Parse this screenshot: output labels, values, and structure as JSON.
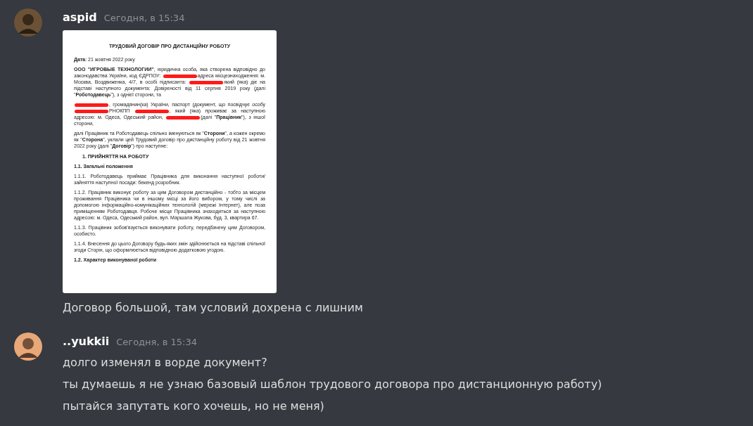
{
  "messages": [
    {
      "author": "aspid",
      "timestamp": "Сегодня, в 15:34",
      "attachment": {
        "kind": "document",
        "blocks": [
          {
            "kind": "title",
            "parts": [
              {
                "kind": "text",
                "text": "ТРУДОВИЙ ДОГОВІР ПРО ДИСТАНЦІЙНУ РОБОТУ"
              }
            ]
          },
          {
            "kind": "para",
            "parts": [
              {
                "kind": "text",
                "text": "**Дата**: 21 жовтня 2022 року"
              }
            ]
          },
          {
            "kind": "para",
            "parts": [
              {
                "kind": "text",
                "text": "**ООО \"ИГРОВЫЕ ТЕХНОЛОГИИ\"**, юридична особа, яка створена відповідно до законодавства України, код ЄДРПОУ:"
              },
              {
                "kind": "redaction"
              },
              {
                "kind": "text",
                "text": "адреса місцезнаходження: м. Москва, Воздвиженка, 4/7, в особі підписанта:"
              },
              {
                "kind": "redaction"
              },
              {
                "kind": "text",
                "text": "який (яка) діє на підставі наступного документа: Довіреності від 11 серпня 2019 року (далі \"**Роботодавець**\"), з однієї сторони, та"
              }
            ]
          },
          {
            "kind": "para",
            "parts": [
              {
                "kind": "redaction"
              },
              {
                "kind": "text",
                "text": ", громадянин(ка) України, паспорт (документ, що посвідчує особу"
              },
              {
                "kind": "redaction"
              },
              {
                "kind": "text",
                "text": "РНОКПП"
              },
              {
                "kind": "redaction"
              },
              {
                "kind": "text",
                "text": ", який (яка) проживає за наступною адресою: м. Одеса, Одеський район,"
              },
              {
                "kind": "redaction"
              },
              {
                "kind": "text",
                "text": "(далі \"**Працівник**\"), з іншої сторони,"
              }
            ]
          },
          {
            "kind": "para",
            "parts": [
              {
                "kind": "text",
                "text": "далі Працівник та Роботодавець спільно іменуються як \"**Сторони**\", а кожен окремо як \"**Сторона**\", уклали цей Трудовий договір про дистанційну роботу від 21 жовтня 2022 року (далі \"**Договір**\") про наступне:"
              }
            ]
          },
          {
            "kind": "heading",
            "parts": [
              {
                "kind": "text",
                "text": "1. ПРИЙНЯТТЯ НА РОБОТУ"
              }
            ]
          },
          {
            "kind": "subheading",
            "parts": [
              {
                "kind": "text",
                "text": "1.1. Загальні положення"
              }
            ]
          },
          {
            "kind": "para",
            "parts": [
              {
                "kind": "text",
                "text": "1.1.1. Роботодавець приймає Працівника для виконання наступної роботи/зайняття наступної посади: бекенд розробник."
              }
            ]
          },
          {
            "kind": "para",
            "parts": [
              {
                "kind": "text",
                "text": "1.1.2. Працівник виконує роботу за цим Договором дистанційно - тобто за місцем проживання Працівника чи в іншому місці за його вибором, у тому числі за допомогою інформаційно-комунікаційних технологій (мережі Інтернет), але поза приміщенням Роботодавця. Робоче місце Працівника знаходиться за наступною адресою: м. Одеса, Одеський район, вул. Маршала Жукова, буд. 3, квартира 67."
              }
            ]
          },
          {
            "kind": "para",
            "parts": [
              {
                "kind": "text",
                "text": "1.1.3. Працівник зобов'язується виконувати роботу, передбачену цим Договором, особисто."
              }
            ]
          },
          {
            "kind": "para",
            "parts": [
              {
                "kind": "text",
                "text": "1.1.4. Внесення до цього Договору будь-яких змін здійснюється на підставі спільної згоди Сторін, що оформлюється відповідною додатковою угодою."
              }
            ]
          },
          {
            "kind": "subheading",
            "parts": [
              {
                "kind": "text",
                "text": "1.2. Характер виконуваної роботи"
              }
            ]
          }
        ]
      },
      "lines": [
        "Договор большой, там условий дохрена с лишним"
      ]
    },
    {
      "author": "..yukkii",
      "timestamp": "Сегодня, в 15:34",
      "lines": [
        "долго изменял в ворде документ?",
        "ты думаешь я не узнаю базовый шаблон трудового договора про дистанционную работу)",
        "пытайся запутать кого хочешь, но не меня)"
      ]
    }
  ]
}
